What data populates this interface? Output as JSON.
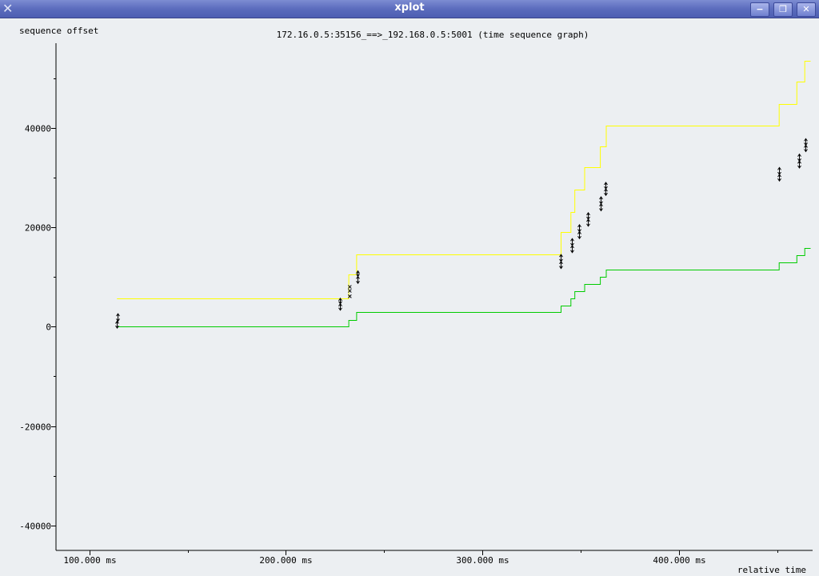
{
  "window": {
    "title": "xplot",
    "icon": "xplot-x-icon",
    "buttons": [
      "minimize-icon",
      "maximize-icon",
      "close-icon"
    ]
  },
  "chart_data": {
    "type": "line",
    "title": "172.16.0.5:35156_==>_192.168.0.5:5001 (time sequence graph)",
    "ylabel": "sequence offset",
    "xlabel": "relative time",
    "xlim": [
      83000,
      468000
    ],
    "ylim": [
      -45000,
      57000
    ],
    "x_ticks": [
      100000,
      200000,
      300000,
      400000
    ],
    "x_tick_labels": [
      "100.000 ms",
      "200.000 ms",
      "300.000 ms",
      "400.000 ms"
    ],
    "x_minor_ticks": [
      150000,
      250000,
      350000,
      450000
    ],
    "y_ticks": [
      -40000,
      -20000,
      0,
      20000,
      40000
    ],
    "y_tick_labels": [
      "-40000",
      "-20000",
      "0",
      "20000",
      "40000"
    ],
    "y_minor_ticks": [
      -30000,
      -10000,
      10000,
      30000,
      50000
    ],
    "colors": {
      "background": "#eceff2",
      "axis": "#000000",
      "window_edge": "#5566c0",
      "window_advertised": "#ffff00",
      "ack": "#00cc00",
      "segment": "#000000"
    },
    "series": [
      {
        "style": "step",
        "color": "#ffff00",
        "points": [
          [
            114000,
            5600
          ],
          [
            228000,
            5600
          ],
          [
            228000,
            5700
          ],
          [
            232000,
            5700
          ],
          [
            232000,
            10500
          ],
          [
            236000,
            10500
          ],
          [
            236000,
            14500
          ],
          [
            340000,
            14500
          ],
          [
            340000,
            19000
          ],
          [
            345000,
            19000
          ],
          [
            345000,
            23000
          ],
          [
            347000,
            23000
          ],
          [
            347000,
            27500
          ],
          [
            352000,
            27500
          ],
          [
            352000,
            32000
          ],
          [
            360000,
            32000
          ],
          [
            360000,
            36200
          ],
          [
            363000,
            36200
          ],
          [
            363000,
            40500
          ],
          [
            451000,
            40500
          ],
          [
            451000,
            44800
          ],
          [
            460000,
            44800
          ],
          [
            460000,
            49200
          ],
          [
            464000,
            49200
          ],
          [
            464000,
            53500
          ],
          [
            467000,
            53500
          ]
        ]
      },
      {
        "style": "step",
        "color": "#00cc00",
        "points": [
          [
            114000,
            0
          ],
          [
            232000,
            0
          ],
          [
            232000,
            1400
          ],
          [
            236000,
            1400
          ],
          [
            236000,
            2900
          ],
          [
            340000,
            2900
          ],
          [
            340000,
            4300
          ],
          [
            345000,
            4300
          ],
          [
            345000,
            5700
          ],
          [
            347000,
            5700
          ],
          [
            347000,
            7100
          ],
          [
            352000,
            7100
          ],
          [
            352000,
            8500
          ],
          [
            360000,
            8500
          ],
          [
            360000,
            10000
          ],
          [
            363000,
            10000
          ],
          [
            363000,
            11400
          ],
          [
            451000,
            11400
          ],
          [
            451000,
            12900
          ],
          [
            460000,
            12900
          ],
          [
            460000,
            14400
          ],
          [
            464000,
            14400
          ],
          [
            464000,
            15800
          ],
          [
            467000,
            15800
          ]
        ]
      },
      {
        "style": "segments",
        "color": "#000000",
        "segments": [
          [
            114000,
            -300,
            1100
          ],
          [
            114500,
            1100,
            2600
          ],
          [
            227500,
            3300,
            4600
          ],
          [
            227500,
            4600,
            5700
          ],
          [
            236500,
            8700,
            10100
          ],
          [
            236500,
            10100,
            11200
          ],
          [
            340000,
            11700,
            13100
          ],
          [
            340000,
            13100,
            14500
          ],
          [
            345500,
            14900,
            16300
          ],
          [
            345500,
            16300,
            17700
          ],
          [
            349000,
            17700,
            19100
          ],
          [
            349000,
            19100,
            20500
          ],
          [
            353500,
            20200,
            21600
          ],
          [
            353500,
            21600,
            22900
          ],
          [
            360000,
            23300,
            24700
          ],
          [
            360000,
            24700,
            26100
          ],
          [
            362500,
            26400,
            27700
          ],
          [
            362500,
            27700,
            29000
          ],
          [
            451000,
            29300,
            30600
          ],
          [
            451000,
            30600,
            32000
          ],
          [
            461000,
            31900,
            33300
          ],
          [
            461000,
            33300,
            34700
          ],
          [
            464500,
            35200,
            36500
          ],
          [
            464500,
            36500,
            37800
          ]
        ]
      },
      {
        "style": "marks",
        "color": "#000000",
        "points": [
          [
            232500,
            6100
          ],
          [
            232500,
            7200
          ],
          [
            232500,
            8000
          ]
        ]
      }
    ]
  }
}
